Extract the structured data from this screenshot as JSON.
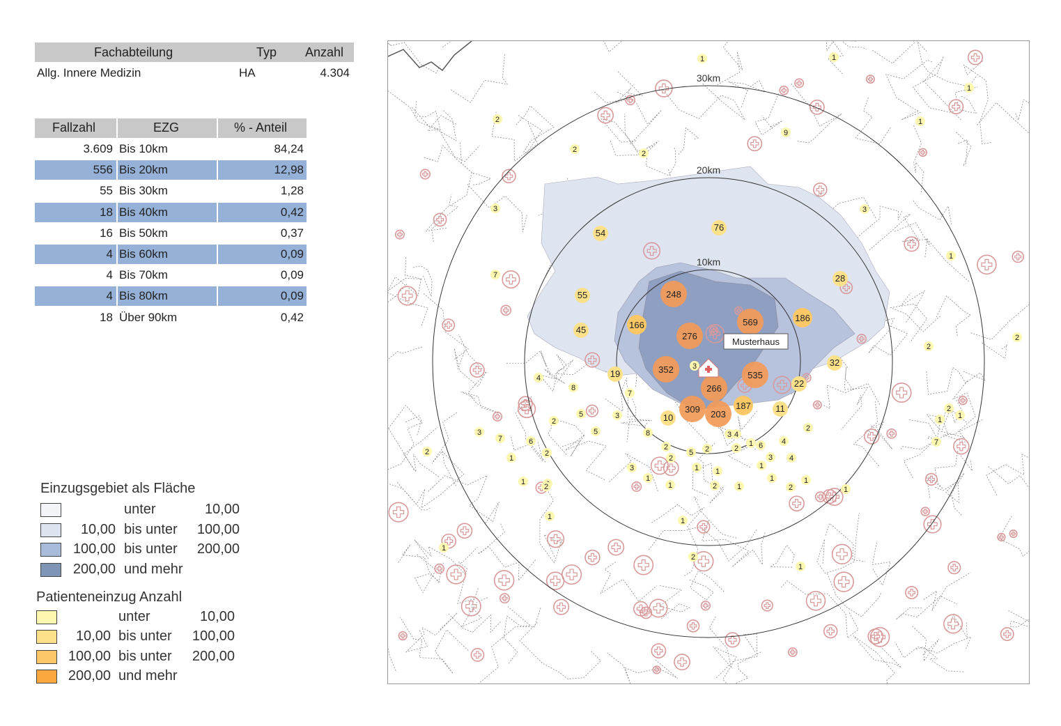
{
  "department_table": {
    "headers": [
      "Fachabteilung",
      "Typ",
      "Anzahl"
    ],
    "row": {
      "name": "Allg. Innere Medizin",
      "type": "HA",
      "count": "4.304"
    }
  },
  "ezg_table": {
    "headers": [
      "Fallzahl",
      "EZG",
      "% - Anteil"
    ],
    "rows": [
      {
        "count": "3.609",
        "zone": "Bis 10km",
        "share": "84,24"
      },
      {
        "count": "556",
        "zone": "Bis 20km",
        "share": "12,98"
      },
      {
        "count": "55",
        "zone": "Bis 30km",
        "share": "1,28"
      },
      {
        "count": "18",
        "zone": "Bis 40km",
        "share": "0,42"
      },
      {
        "count": "16",
        "zone": "Bis 50km",
        "share": "0,37"
      },
      {
        "count": "4",
        "zone": "Bis 60km",
        "share": "0,09"
      },
      {
        "count": "4",
        "zone": "Bis 70km",
        "share": "0,09"
      },
      {
        "count": "4",
        "zone": "Bis 80km",
        "share": "0,09"
      },
      {
        "count": "18",
        "zone": "Über 90km",
        "share": "0,42"
      }
    ]
  },
  "legend_area": {
    "title": "Einzugsgebiet als Fläche",
    "items": [
      {
        "from": "",
        "word": "unter",
        "to": "10,00",
        "color": "#f2f4f8"
      },
      {
        "from": "10,00",
        "word": "bis unter",
        "to": "100,00",
        "color": "#dde4f0"
      },
      {
        "from": "100,00",
        "word": "bis unter",
        "to": "200,00",
        "color": "#a9bbdb"
      },
      {
        "from": "200,00",
        "word": "und mehr",
        "to": "",
        "color": "#7e95b8"
      }
    ]
  },
  "legend_patients": {
    "title": "Patienteneinzug Anzahl",
    "items": [
      {
        "from": "",
        "word": "unter",
        "to": "10,00",
        "color": "#fdf7b0"
      },
      {
        "from": "10,00",
        "word": "bis unter",
        "to": "100,00",
        "color": "#fde18a"
      },
      {
        "from": "100,00",
        "word": "bis unter",
        "to": "200,00",
        "color": "#fcc767"
      },
      {
        "from": "200,00",
        "word": "und mehr",
        "to": "",
        "color": "#fba93e"
      }
    ]
  },
  "map": {
    "ring_labels": [
      "10km",
      "20km",
      "30km"
    ],
    "hospital_label": "Musterhaus",
    "colors": {
      "region_light": "#dfe4f1",
      "region_mid": "#b7c2dc",
      "region_dark": "#8f9fc1",
      "ring": "#333333",
      "hospital_symbol": "#d9999a"
    },
    "markers": [
      {
        "v": "248",
        "tier": 4
      },
      {
        "v": "569",
        "tier": 4
      },
      {
        "v": "276",
        "tier": 4
      },
      {
        "v": "352",
        "tier": 4
      },
      {
        "v": "535",
        "tier": 4
      },
      {
        "v": "266",
        "tier": 4
      },
      {
        "v": "309",
        "tier": 4
      },
      {
        "v": "203",
        "tier": 4
      },
      {
        "v": "166",
        "tier": 3
      },
      {
        "v": "186",
        "tier": 3
      },
      {
        "v": "187",
        "tier": 3
      },
      {
        "v": "54",
        "tier": 2
      },
      {
        "v": "76",
        "tier": 2
      },
      {
        "v": "55",
        "tier": 2
      },
      {
        "v": "45",
        "tier": 2
      },
      {
        "v": "28",
        "tier": 2
      },
      {
        "v": "32",
        "tier": 2
      },
      {
        "v": "19",
        "tier": 2
      },
      {
        "v": "22",
        "tier": 2
      },
      {
        "v": "11",
        "tier": 2
      },
      {
        "v": "10",
        "tier": 2
      },
      {
        "v": "3",
        "tier": 1
      },
      {
        "v": "1",
        "tier": 1
      },
      {
        "v": "1",
        "tier": 1
      },
      {
        "v": "1",
        "tier": 1
      },
      {
        "v": "1",
        "tier": 1
      },
      {
        "v": "2",
        "tier": 1
      },
      {
        "v": "9",
        "tier": 1
      },
      {
        "v": "2",
        "tier": 1
      },
      {
        "v": "2",
        "tier": 1
      },
      {
        "v": "3",
        "tier": 1
      },
      {
        "v": "3",
        "tier": 1
      },
      {
        "v": "1",
        "tier": 1
      },
      {
        "v": "7",
        "tier": 1
      },
      {
        "v": "2",
        "tier": 1
      },
      {
        "v": "2",
        "tier": 1
      },
      {
        "v": "4",
        "tier": 1
      },
      {
        "v": "8",
        "tier": 1
      },
      {
        "v": "7",
        "tier": 1
      },
      {
        "v": "5",
        "tier": 1
      },
      {
        "v": "3",
        "tier": 1
      },
      {
        "v": "2",
        "tier": 1
      },
      {
        "v": "5",
        "tier": 1
      },
      {
        "v": "8",
        "tier": 1
      },
      {
        "v": "2",
        "tier": 1
      },
      {
        "v": "2",
        "tier": 1
      },
      {
        "v": "3",
        "tier": 1
      },
      {
        "v": "2",
        "tier": 1
      },
      {
        "v": "1",
        "tier": 1
      },
      {
        "v": "6",
        "tier": 1
      },
      {
        "v": "4",
        "tier": 1
      },
      {
        "v": "2",
        "tier": 1
      },
      {
        "v": "5",
        "tier": 1
      },
      {
        "v": "4",
        "tier": 1
      },
      {
        "v": "4",
        "tier": 1
      },
      {
        "v": "1",
        "tier": 1
      },
      {
        "v": "1",
        "tier": 1
      },
      {
        "v": "7",
        "tier": 1
      },
      {
        "v": "3",
        "tier": 1
      },
      {
        "v": "7",
        "tier": 1
      },
      {
        "v": "6",
        "tier": 1
      },
      {
        "v": "1",
        "tier": 1
      },
      {
        "v": "2",
        "tier": 1
      },
      {
        "v": "2",
        "tier": 1
      },
      {
        "v": "1",
        "tier": 1
      },
      {
        "v": "3",
        "tier": 1
      },
      {
        "v": "3",
        "tier": 1
      },
      {
        "v": "1",
        "tier": 1
      },
      {
        "v": "2",
        "tier": 1
      },
      {
        "v": "1",
        "tier": 1
      },
      {
        "v": "3",
        "tier": 1
      },
      {
        "v": "1",
        "tier": 1
      },
      {
        "v": "2",
        "tier": 1
      },
      {
        "v": "1",
        "tier": 1
      },
      {
        "v": "1",
        "tier": 1
      },
      {
        "v": "1",
        "tier": 1
      },
      {
        "v": "2",
        "tier": 1
      },
      {
        "v": "1",
        "tier": 1
      },
      {
        "v": "1",
        "tier": 1
      },
      {
        "v": "2",
        "tier": 1
      },
      {
        "v": "1",
        "tier": 1
      },
      {
        "v": "1",
        "tier": 1
      },
      {
        "v": "1",
        "tier": 1
      },
      {
        "v": "1",
        "tier": 1
      },
      {
        "v": "2",
        "tier": 1
      },
      {
        "v": "2",
        "tier": 1
      },
      {
        "v": "1",
        "tier": 1
      }
    ]
  }
}
